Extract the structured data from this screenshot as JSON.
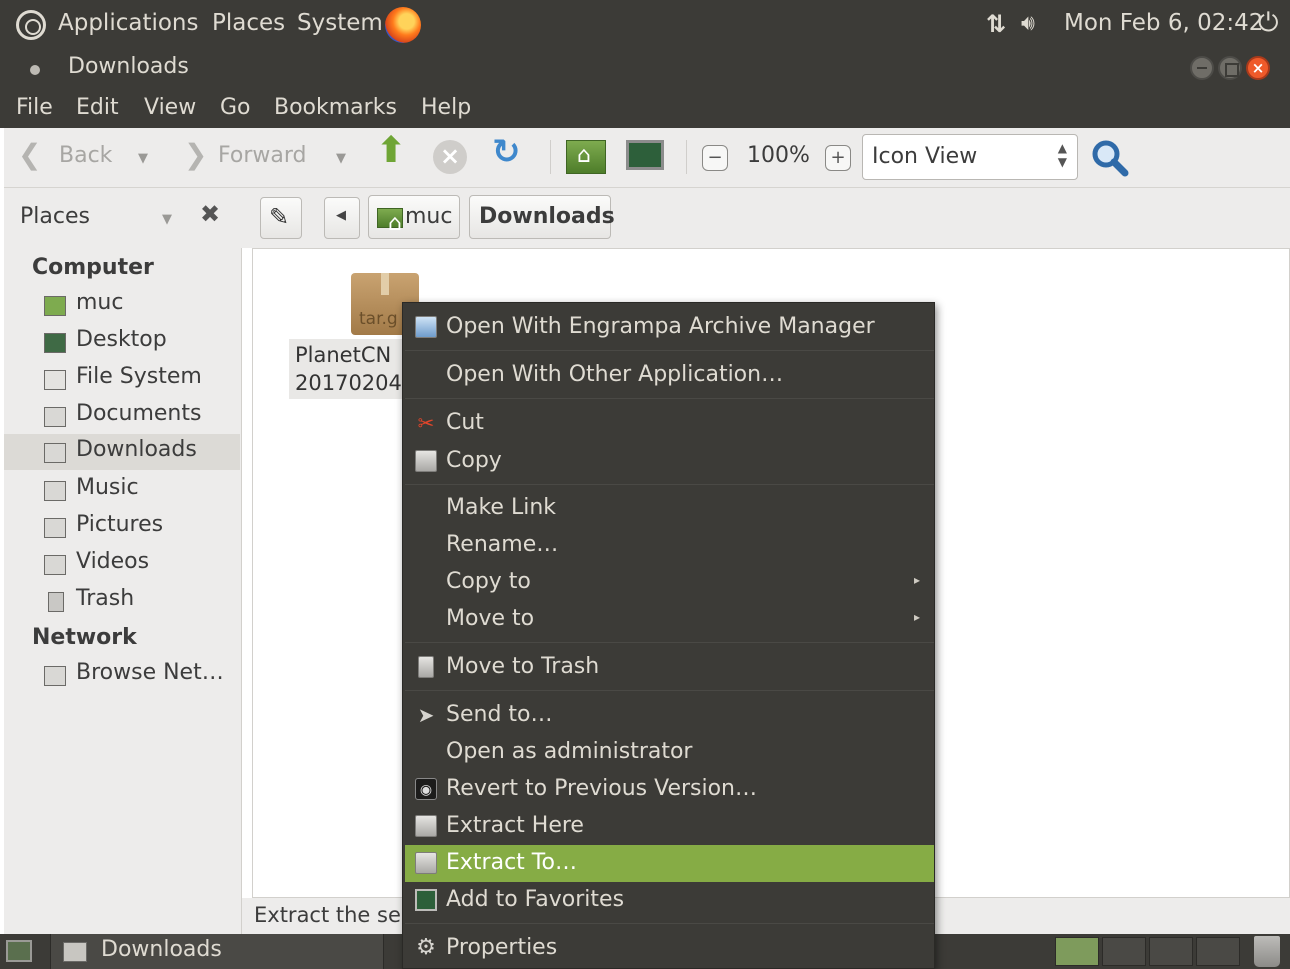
{
  "top_panel": {
    "menus": [
      "Applications",
      "Places",
      "System"
    ],
    "clock": "Mon Feb  6, 02:42",
    "icons": [
      "ubuntu-logo-icon",
      "firefox-icon",
      "network-icon",
      "volume-icon",
      "power-icon"
    ]
  },
  "window": {
    "title": "Downloads"
  },
  "menubar": [
    "File",
    "Edit",
    "View",
    "Go",
    "Bookmarks",
    "Help"
  ],
  "toolbar": {
    "back": "Back",
    "forward": "Forward",
    "zoom": "100%",
    "view_mode": "Icon View"
  },
  "locationbar": {
    "side_pane_label": "Places",
    "breadcrumbs": [
      "muc",
      "Downloads"
    ]
  },
  "sidebar": {
    "computer_header": "Computer",
    "computer_items": [
      {
        "label": "muc",
        "icon": "home-folder-icon"
      },
      {
        "label": "Desktop",
        "icon": "desktop-icon"
      },
      {
        "label": "File System",
        "icon": "harddisk-icon"
      },
      {
        "label": "Documents",
        "icon": "documents-folder-icon"
      },
      {
        "label": "Downloads",
        "icon": "downloads-folder-icon",
        "selected": true
      },
      {
        "label": "Music",
        "icon": "music-folder-icon"
      },
      {
        "label": "Pictures",
        "icon": "pictures-folder-icon"
      },
      {
        "label": "Videos",
        "icon": "videos-folder-icon"
      },
      {
        "label": "Trash",
        "icon": "trash-icon"
      }
    ],
    "network_header": "Network",
    "network_items": [
      {
        "label": "Browse Net…",
        "icon": "network-folder-icon"
      }
    ]
  },
  "main": {
    "file": {
      "icon_ext": "tar.g",
      "name_line1": "PlanetCN",
      "name_line2": "20170204"
    }
  },
  "statusbar": {
    "text": "Extract the se"
  },
  "context_menu": {
    "items": [
      {
        "label": "Open With Engrampa Archive Manager",
        "icon": "engrampa-icon"
      },
      {
        "label": "Open With Other Application…"
      },
      {
        "label": "Cut",
        "icon": "scissors-icon"
      },
      {
        "label": "Copy",
        "icon": "copy-icon"
      },
      {
        "label": "Make Link"
      },
      {
        "label": "Rename…"
      },
      {
        "label": "Copy to",
        "submenu": true
      },
      {
        "label": "Move to",
        "submenu": true
      },
      {
        "label": "Move to Trash",
        "icon": "trash-icon"
      },
      {
        "label": "Send to…",
        "icon": "send-icon"
      },
      {
        "label": "Open as administrator"
      },
      {
        "label": "Revert to Previous Version…",
        "icon": "camera-icon"
      },
      {
        "label": "Extract Here",
        "icon": "archive-icon"
      },
      {
        "label": "Extract To…",
        "icon": "archive-icon",
        "highlighted": true
      },
      {
        "label": "Add to Favorites",
        "icon": "favorites-icon"
      },
      {
        "label": "Properties",
        "icon": "gear-icon"
      }
    ]
  },
  "bottom_panel": {
    "task_label": "Downloads"
  },
  "colors": {
    "panel": "#3c3b37",
    "highlight": "#86ac45",
    "window_bg": "#edeceb"
  }
}
